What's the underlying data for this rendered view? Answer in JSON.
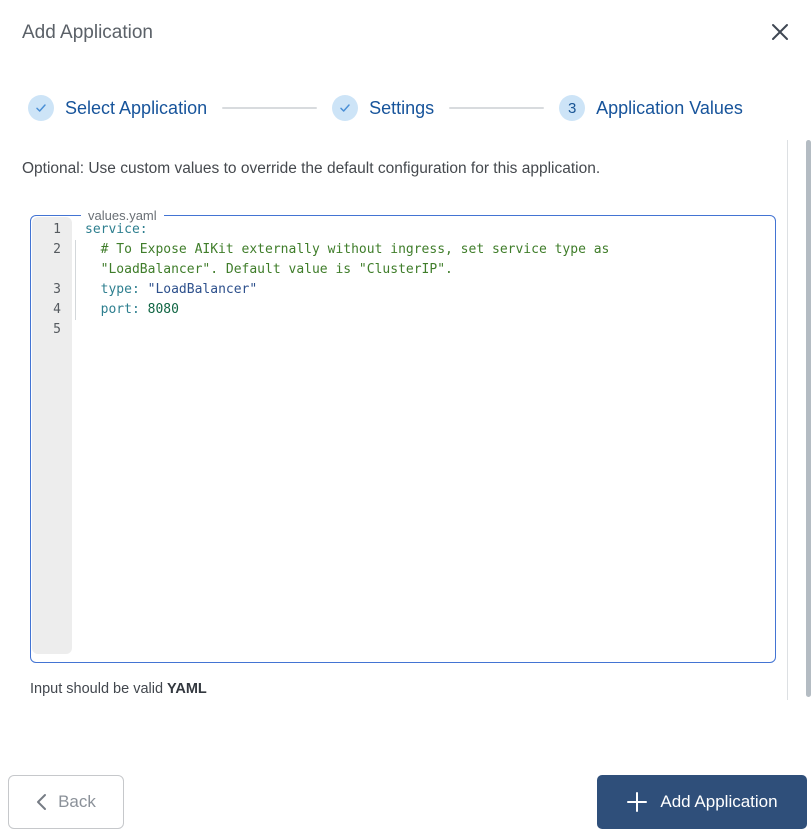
{
  "dialog": {
    "title": "Add Application"
  },
  "stepper": {
    "steps": [
      {
        "id": "select-application",
        "label": "Select Application",
        "state": "done"
      },
      {
        "id": "settings",
        "label": "Settings",
        "state": "done"
      },
      {
        "id": "application-values",
        "label": "Application Values",
        "state": "current",
        "number": "3"
      }
    ]
  },
  "description": "Optional: Use custom values to override the default configuration for this application.",
  "editor": {
    "filename": "values.yaml",
    "rows": [
      {
        "num": "1",
        "indent": false,
        "segments": [
          {
            "text": "service:",
            "type": "key"
          }
        ]
      },
      {
        "num": "2",
        "indent": true,
        "segments": [
          {
            "text": "  # To Expose AIKit externally without ingress, set service type as",
            "type": "comment"
          }
        ]
      },
      {
        "num": "",
        "indent": true,
        "segments": [
          {
            "text": "  \"LoadBalancer\". Default value is \"ClusterIP\".",
            "type": "comment"
          }
        ]
      },
      {
        "num": "3",
        "indent": true,
        "segments": [
          {
            "text": "  type:",
            "type": "key"
          },
          {
            "text": " ",
            "type": "plain"
          },
          {
            "text": "\"LoadBalancer\"",
            "type": "string"
          }
        ]
      },
      {
        "num": "4",
        "indent": true,
        "segments": [
          {
            "text": "  port:",
            "type": "key"
          },
          {
            "text": " ",
            "type": "plain"
          },
          {
            "text": "8080",
            "type": "number"
          }
        ]
      },
      {
        "num": "5",
        "indent": false,
        "segments": []
      }
    ]
  },
  "hint": {
    "prefix": "Input should be valid ",
    "emphasis": "YAML"
  },
  "footer": {
    "back_label": "Back",
    "add_label": "Add Application"
  },
  "colors": {
    "accent_blue": "#17549b",
    "step_circle_bg": "#cde4f7",
    "editor_border": "#4374d3",
    "primary_button_bg": "#2f4f7a",
    "comment_green": "#3f7d2a",
    "key_teal": "#2e7f8f",
    "string_navy": "#2d508c",
    "number_green": "#116644"
  }
}
